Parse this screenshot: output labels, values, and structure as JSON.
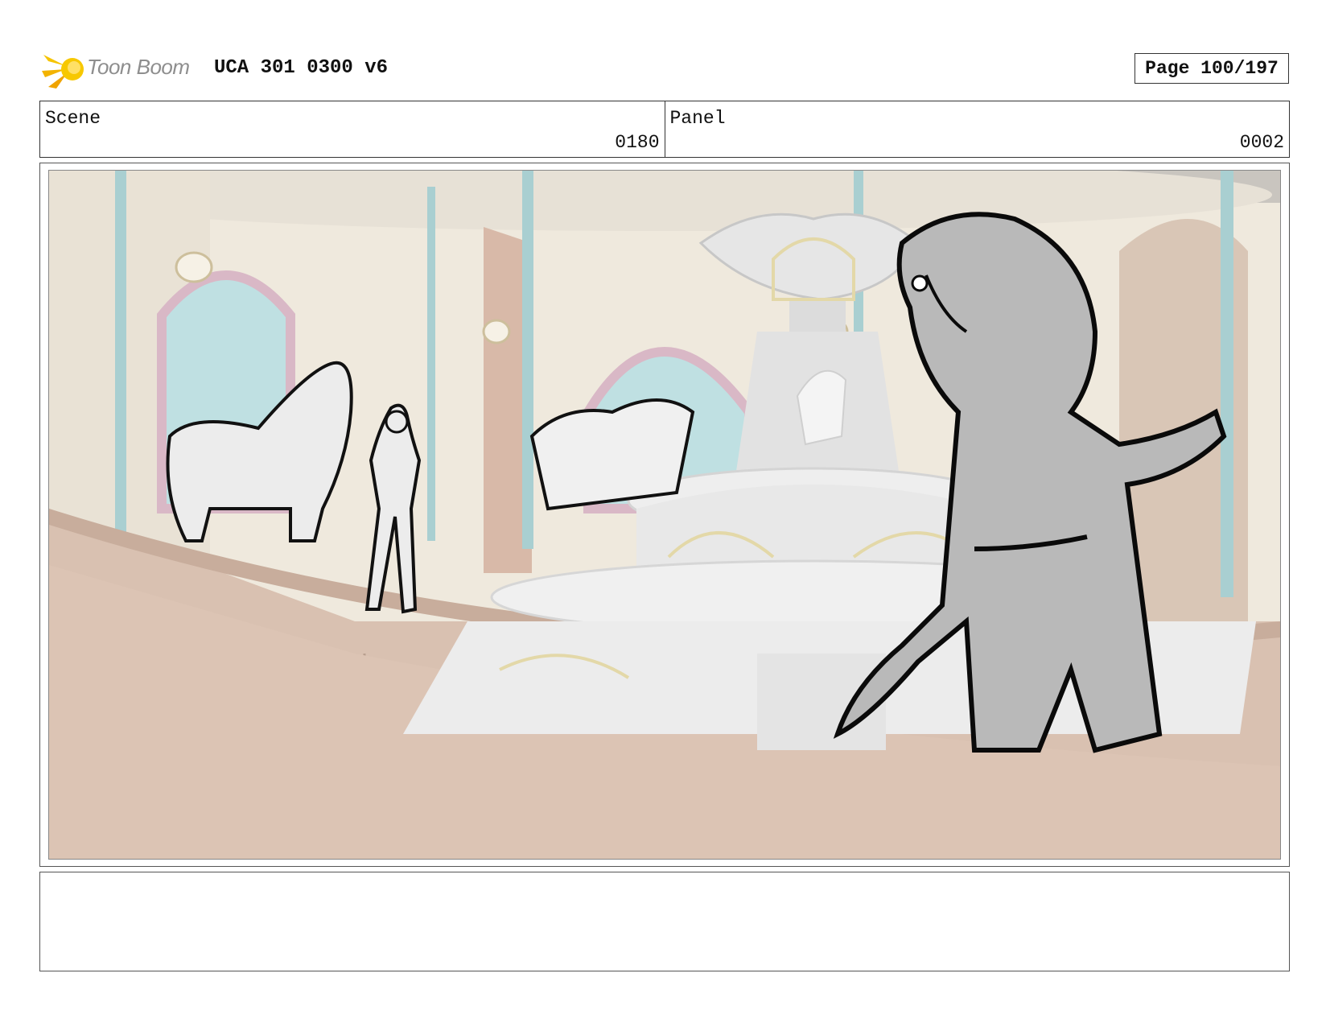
{
  "header": {
    "logo_text": "Toon Boom",
    "title": "UCA 301 0300 v6",
    "page": "Page 100/197"
  },
  "info": {
    "scene_label": "Scene",
    "scene_value": "0180",
    "panel_label": "Panel",
    "panel_value": "0002"
  },
  "notes": {
    "text": ""
  }
}
